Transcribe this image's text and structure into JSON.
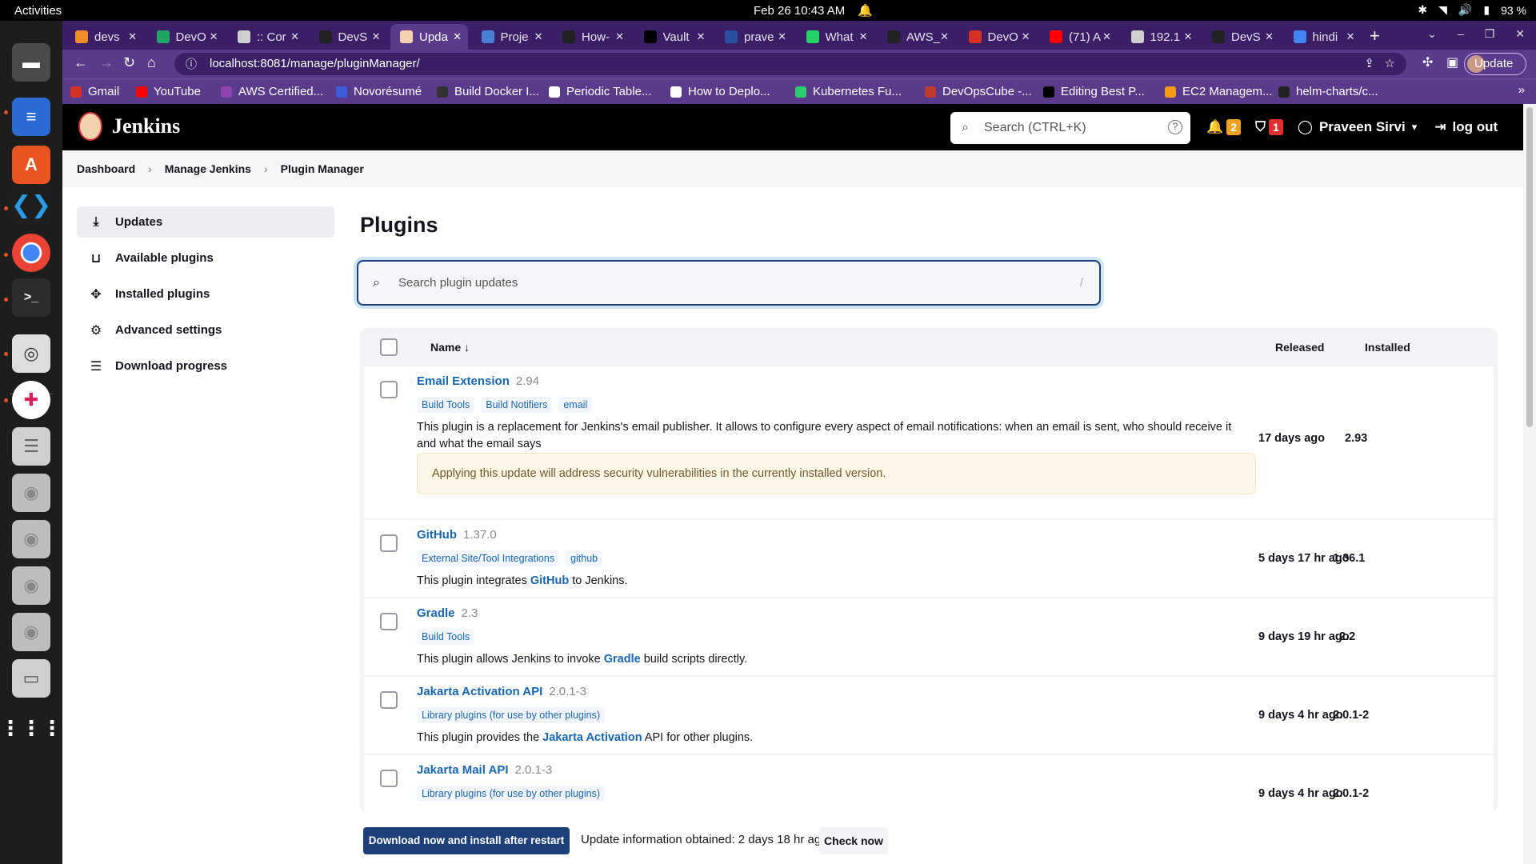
{
  "os": {
    "activities": "Activities",
    "clock": "Feb 26  10:43 AM",
    "battery": "93 %"
  },
  "browser": {
    "tabs": [
      {
        "title": "devs",
        "color": "#f28c28"
      },
      {
        "title": "DevO",
        "color": "#1fa463"
      },
      {
        "title": ":: Cor",
        "color": "#cfcfcf"
      },
      {
        "title": "DevS",
        "color": "#222222"
      },
      {
        "title": "Upda",
        "color": "#f4d2b0"
      },
      {
        "title": "Proje",
        "color": "#4a7fd4"
      },
      {
        "title": "How-",
        "color": "#222222"
      },
      {
        "title": "Vault",
        "color": "#000000"
      },
      {
        "title": "prave",
        "color": "#2a4ea0"
      },
      {
        "title": "What",
        "color": "#25d366"
      },
      {
        "title": "AWS_",
        "color": "#222222"
      },
      {
        "title": "DevO",
        "color": "#d93025"
      },
      {
        "title": "(71) A",
        "color": "#ff0000"
      },
      {
        "title": "192.1",
        "color": "#cfcfcf"
      },
      {
        "title": "DevS",
        "color": "#222222"
      },
      {
        "title": "hindi",
        "color": "#4285f4"
      }
    ],
    "url": "localhost:8081/manage/pluginManager/",
    "update_label": "Update",
    "bookmarks": [
      {
        "label": "Gmail",
        "color": "#d93025"
      },
      {
        "label": "YouTube",
        "color": "#ff0000"
      },
      {
        "label": "AWS Certified...",
        "color": "#8e44ad"
      },
      {
        "label": "Novorésumé",
        "color": "#3b5bdb"
      },
      {
        "label": "Build Docker I...",
        "color": "#333333"
      },
      {
        "label": "Periodic Table...",
        "color": "#ffffff"
      },
      {
        "label": "How to Deplo...",
        "color": "#ffffff"
      },
      {
        "label": "Kubernetes Fu...",
        "color": "#2ecc71"
      },
      {
        "label": "DevOpsCube -...",
        "color": "#c0392b"
      },
      {
        "label": "Editing Best P...",
        "color": "#000000"
      },
      {
        "label": "EC2 Managem...",
        "color": "#f39c12"
      },
      {
        "label": "helm-charts/c...",
        "color": "#222222"
      }
    ]
  },
  "jenkins": {
    "brand": "Jenkins",
    "search_placeholder": "Search (CTRL+K)",
    "notifications_count": "2",
    "security_count": "1",
    "user": "Praveen Sirvi",
    "logout": "log out",
    "breadcrumb": [
      "Dashboard",
      "Manage Jenkins",
      "Plugin Manager"
    ],
    "sidebar": [
      {
        "label": "Updates",
        "icon": "download-icon",
        "active": true
      },
      {
        "label": "Available plugins",
        "icon": "shopping-bag-icon"
      },
      {
        "label": "Installed plugins",
        "icon": "puzzle-icon"
      },
      {
        "label": "Advanced settings",
        "icon": "gear-icon"
      },
      {
        "label": "Download progress",
        "icon": "list-icon"
      }
    ],
    "title": "Plugins",
    "plugin_search_placeholder": "Search plugin updates",
    "plugin_search_shortcut": "/",
    "columns": {
      "name": "Name ↓",
      "released": "Released",
      "installed": "Installed"
    },
    "plugins": [
      {
        "name": "Email Extension",
        "version": "2.94",
        "labels": [
          "Build Tools",
          "Build Notifiers",
          "email"
        ],
        "description": "This plugin is a replacement for Jenkins's email publisher. It allows to configure every aspect of email notifications: when an email is sent, who should receive it and what the email says",
        "warning": "Applying this update will address security vulnerabilities in the currently installed version.",
        "released": "17 days ago",
        "installed": "2.93"
      },
      {
        "name": "GitHub",
        "version": "1.37.0",
        "labels": [
          "External Site/Tool Integrations",
          "github"
        ],
        "desc_pre": "This plugin integrates ",
        "desc_link": "GitHub",
        "desc_post": " to Jenkins.",
        "released": "5 days 17 hr ago",
        "installed": "1.36.1"
      },
      {
        "name": "Gradle",
        "version": "2.3",
        "labels": [
          "Build Tools"
        ],
        "desc_pre": "This plugin allows Jenkins to invoke ",
        "desc_link": "Gradle",
        "desc_post": " build scripts directly.",
        "released": "9 days 19 hr ago",
        "installed": "2.2"
      },
      {
        "name": "Jakarta Activation API",
        "version": "2.0.1-3",
        "labels": [
          "Library plugins (for use by other plugins)"
        ],
        "desc_pre": "This plugin provides the ",
        "desc_link": "Jakarta Activation",
        "desc_post": " API for other plugins.",
        "released": "9 days 4 hr ago",
        "installed": "2.0.1-2"
      },
      {
        "name": "Jakarta Mail API",
        "version": "2.0.1-3",
        "labels": [
          "Library plugins (for use by other plugins)"
        ],
        "released": "9 days 4 hr ago",
        "installed": "2.0.1-2"
      }
    ],
    "download_button": "Download now and install after restart",
    "update_info": "Update information obtained: 2 days 18 hr ago",
    "check_now": "Check now"
  }
}
